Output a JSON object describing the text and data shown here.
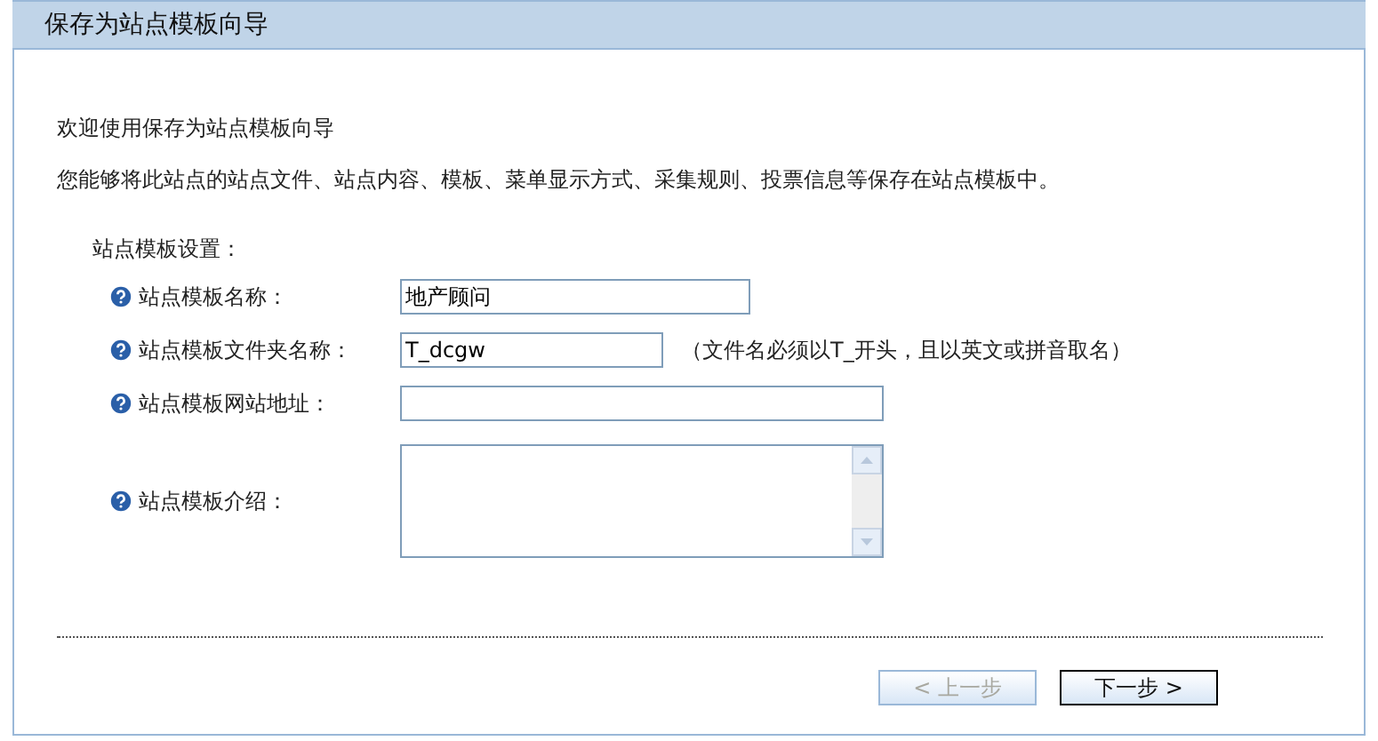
{
  "window": {
    "title": "保存为站点模板向导"
  },
  "intro": {
    "welcome": "欢迎使用保存为站点模板向导",
    "description": "您能够将此站点的站点文件、站点内容、模板、菜单显示方式、采集规则、投票信息等保存在站点模板中。"
  },
  "section": {
    "label": "站点模板设置："
  },
  "fields": [
    {
      "kind": "text",
      "label": "站点模板名称：",
      "value": "地产顾问"
    },
    {
      "kind": "text",
      "label": "站点模板文件夹名称：",
      "value": "T_dcgw",
      "note": "（文件名必须以T_开头，且以英文或拼音取名）"
    },
    {
      "kind": "text",
      "label": "站点模板网站地址："
    },
    {
      "kind": "textarea",
      "label": "站点模板介绍："
    }
  ],
  "buttons": [
    {
      "label": "< 上一步",
      "disabled": true
    },
    {
      "label": "下一步 >",
      "disabled": false
    }
  ]
}
